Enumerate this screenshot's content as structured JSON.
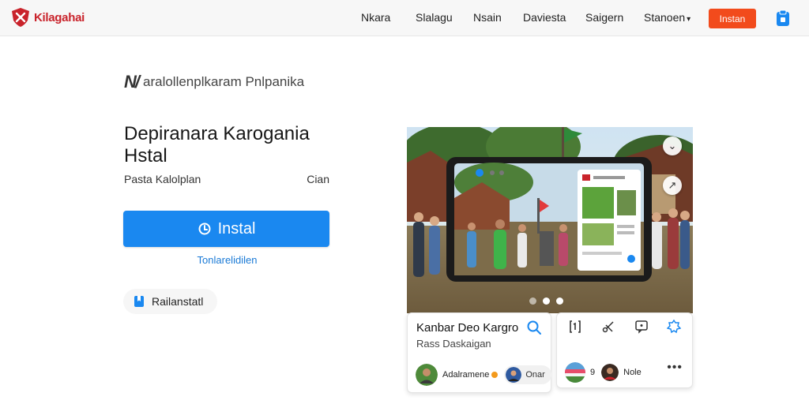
{
  "header": {
    "logo_text": "Kilagahai",
    "nav": [
      "Nkara",
      "Slalagu",
      "Nsain",
      "Daviesta",
      "Saigern"
    ],
    "more_label": "Stanoen",
    "install_label": "Instan"
  },
  "hero": {
    "brand_line": "aralollenplkaram Pnlpanika",
    "title": "Depiranara Karogania Hstal",
    "developer": "Pasta Kalolplan",
    "size": "Cian",
    "install_label": "Instal",
    "sub_link": "Tonlarelidilen",
    "wishlist_label": "Railanstatl"
  },
  "carousel": {
    "dots": 3,
    "active_index": 1
  },
  "info_card": {
    "title": "Kanbar Deo Kargro",
    "subtitle": "Rass Daskaigan",
    "author": "Adalramene",
    "chip_user": "Onar"
  },
  "action_card": {
    "count": "9",
    "user": "Nole",
    "more": "•••"
  },
  "colors": {
    "brand_red": "#c9232b",
    "install_orange": "#f24b1c",
    "primary_blue": "#1a88f0",
    "link_blue": "#1a7ad6"
  }
}
